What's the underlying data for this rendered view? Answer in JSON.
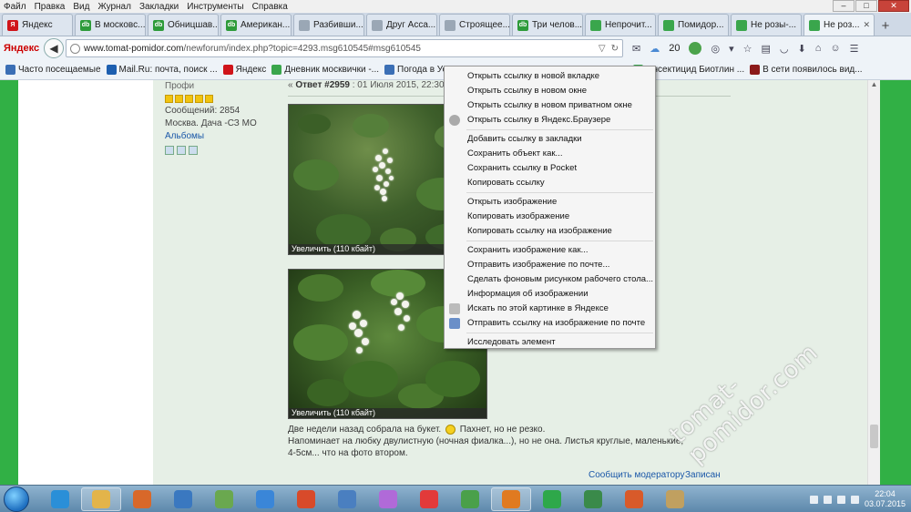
{
  "menubar": {
    "items": [
      "Файл",
      "Правка",
      "Вид",
      "Журнал",
      "Закладки",
      "Инструменты",
      "Справка"
    ]
  },
  "tabs": [
    {
      "label": "Яндекс",
      "icon_color": "#d0141a",
      "icon_text": "Я"
    },
    {
      "label": "В московс...",
      "icon_color": "#2e9b3a",
      "icon_text": "db"
    },
    {
      "label": "Обницшав...",
      "icon_color": "#2e9b3a",
      "icon_text": "db"
    },
    {
      "label": "Американ...",
      "icon_color": "#2e9b3a",
      "icon_text": "db"
    },
    {
      "label": "Разбивши...",
      "icon_color": "#9aa7b5",
      "icon_text": ""
    },
    {
      "label": "Друг Асса...",
      "icon_color": "#9aa7b5",
      "icon_text": ""
    },
    {
      "label": "Строящее...",
      "icon_color": "#9aa7b5",
      "icon_text": ""
    },
    {
      "label": "Три челов...",
      "icon_color": "#2e9b3a",
      "icon_text": "db"
    },
    {
      "label": "Непрочит...",
      "icon_color": "#3aa64c",
      "icon_text": ""
    },
    {
      "label": "Помидор...",
      "icon_color": "#3aa64c",
      "icon_text": ""
    },
    {
      "label": "Не розы-...",
      "icon_color": "#3aa64c",
      "icon_text": ""
    },
    {
      "label": "Не роз...",
      "icon_color": "#3aa64c",
      "icon_text": "",
      "active": true
    }
  ],
  "navbar": {
    "logo": "Яндекс",
    "url_host": "www.tomat-pomidor.com",
    "url_path": "/newforum/index.php?topic=4293.msg610545#msg610545",
    "weather_temp": "20"
  },
  "bookmarks": [
    {
      "label": "Часто посещаемые",
      "icon_color": "#3b6fb5"
    },
    {
      "label": "Mail.Ru: почта, поиск ...",
      "icon_color": "#1d5fb0"
    },
    {
      "label": "Яндекс",
      "icon_color": "#d0141a"
    },
    {
      "label": "Дневник москвички -...",
      "icon_color": "#3aa64c"
    },
    {
      "label": "Погода в Усадах, Мос...",
      "icon_color": "#3b6fb5"
    },
    {
      "label": "Инсектицид Биотлин ...",
      "icon_color": "#3aa64c"
    },
    {
      "label": "В сети появилось вид...",
      "icon_color": "#8b1a1a"
    }
  ],
  "user": {
    "rank": "Профи",
    "stars": 5,
    "messages": "Сообщений: 2854",
    "location": "Москва. Дача -СЗ МО",
    "albums": "Альбомы"
  },
  "post": {
    "header_prefix": "«",
    "reply": "Ответ #2959",
    "date": ": 01 Июля 2015, 22:30:",
    "photo1_caption": "Увеличить (110 кбайт)",
    "photo2_caption": "Увеличить (110 кбайт)",
    "text_line1_a": "Две недели назад собрала на букет.",
    "text_line1_b": "Пахнет, но не резко.",
    "text_line2": "Напоминает на любку двулистную (ночная фиалка...), но не она. Листья круглые, маленькие,",
    "text_line3": "4-5см... что на фото втором.",
    "report": "Сообщить модератору",
    "write": "Записан"
  },
  "context_menu": {
    "groups": [
      [
        "Открыть ссылку в новой вкладке",
        "Открыть ссылку в новом окне",
        "Открыть ссылку в новом приватном окне",
        "Открыть ссылку в Яндекс.Браузере"
      ],
      [
        "Добавить ссылку в закладки",
        "Сохранить объект как...",
        "Сохранить ссылку в Pocket",
        "Копировать ссылку"
      ],
      [
        "Открыть изображение",
        "Копировать изображение",
        "Копировать ссылку на изображение"
      ],
      [
        "Сохранить изображение как...",
        "Отправить изображение по почте...",
        "Сделать фоновым рисунком рабочего стола...",
        "Информация об изображении",
        "Искать по этой картинке в Яндексе",
        "Отправить ссылку на изображение по почте"
      ],
      [
        "Исследовать элемент"
      ]
    ]
  },
  "watermark": "tomat-pomidor.com",
  "taskbar": {
    "time": "22:04",
    "date": "03.07.2015",
    "apps": [
      {
        "name": "ie",
        "color": "#2a8fd8"
      },
      {
        "name": "explorer",
        "color": "#e3b44a",
        "active": true
      },
      {
        "name": "media",
        "color": "#d8682a"
      },
      {
        "name": "box",
        "color": "#3a78c0"
      },
      {
        "name": "people",
        "color": "#6aa84f"
      },
      {
        "name": "mail",
        "color": "#3a86d8"
      },
      {
        "name": "game",
        "color": "#d84a2a"
      },
      {
        "name": "audio",
        "color": "#4a7fc0"
      },
      {
        "name": "bird",
        "color": "#b06ad8"
      },
      {
        "name": "yandex",
        "color": "#e23a3a"
      },
      {
        "name": "chrome",
        "color": "#4aa04a"
      },
      {
        "name": "firefox",
        "color": "#e07a20",
        "active": true
      },
      {
        "name": "icq",
        "color": "#2ea84a"
      },
      {
        "name": "chart",
        "color": "#3a8a4a"
      },
      {
        "name": "office",
        "color": "#d85a2a"
      },
      {
        "name": "paint",
        "color": "#c0a060"
      }
    ]
  }
}
